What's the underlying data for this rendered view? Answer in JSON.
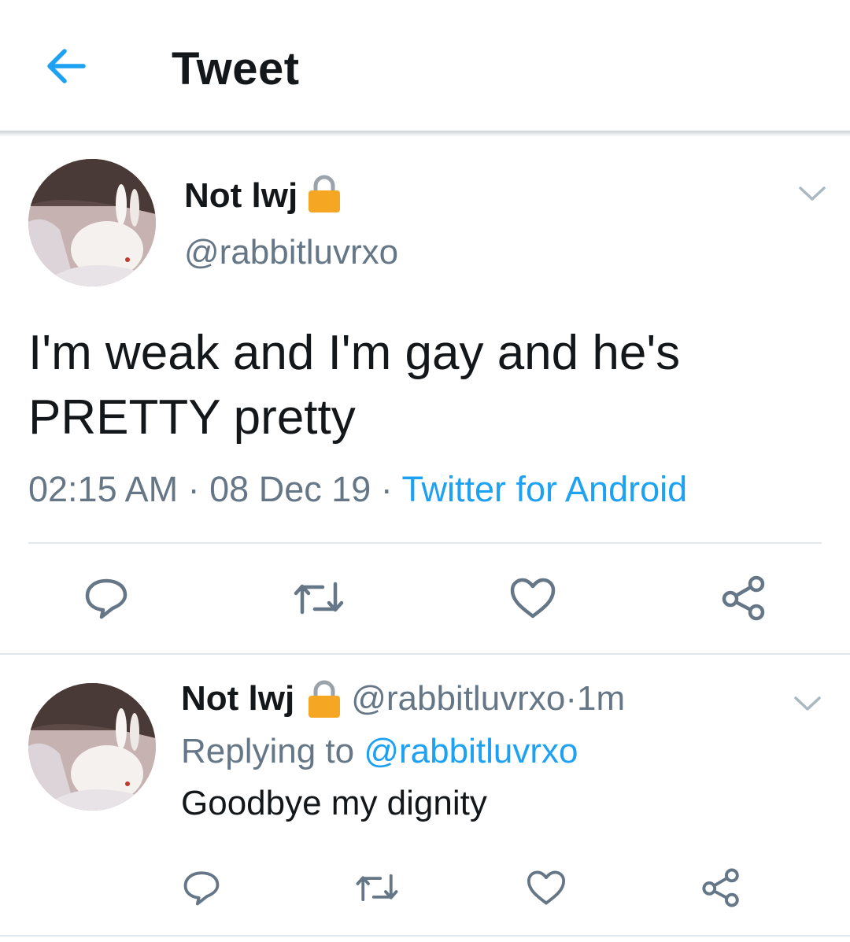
{
  "header": {
    "title": "Tweet",
    "back_icon": "arrow-left-icon",
    "accent_color": "#1da1f2"
  },
  "tweet": {
    "display_name": "Not lwj",
    "protected_icon": "lock-icon",
    "handle": "@rabbitluvrxo",
    "text_line1": "I'm weak and I'm gay and he's",
    "text_line2": "PRETTY pretty",
    "time": "02:15 AM",
    "separator1": " · ",
    "date": "08 Dec 19",
    "separator2": " · ",
    "source": "Twitter for Android",
    "menu_icon": "chevron-down-icon",
    "actions": [
      "reply-icon",
      "retweet-icon",
      "like-icon",
      "share-icon"
    ]
  },
  "reply": {
    "display_name": "Not lwj",
    "protected_icon": "lock-icon",
    "handle": "@rabbitluvrxo",
    "separator": " · ",
    "age": "1m",
    "replying_label": "Replying to ",
    "replying_handle": "@rabbitluvrxo",
    "text": "Goodbye my dignity",
    "menu_icon": "chevron-down-icon",
    "actions": [
      "reply-icon",
      "retweet-icon",
      "like-icon",
      "share-icon"
    ]
  },
  "colors": {
    "text_primary": "#14171a",
    "text_secondary": "#657786",
    "link": "#1da1f2",
    "lock": "#f5a623",
    "divider": "#e1e8ed"
  }
}
